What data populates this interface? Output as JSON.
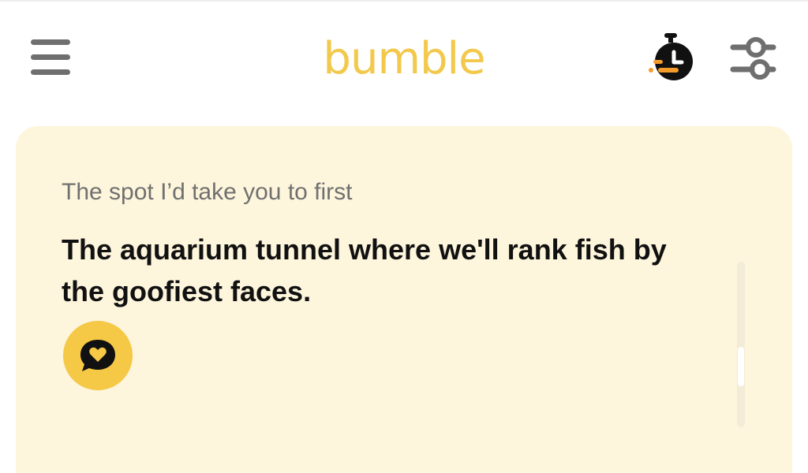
{
  "header": {
    "logo_text": "bumble",
    "menu_icon": "hamburger-menu-icon",
    "timer_icon": "stopwatch-icon",
    "filter_icon": "filter-sliders-icon"
  },
  "profile_card": {
    "prompt_label": "The spot I’d take you to first",
    "answer_text": "The aquarium tunnel where we'll rank fish by the goofiest faces.",
    "comment_icon": "heart-chat-bubble-icon"
  },
  "colors": {
    "brand_yellow": "#f2c94c",
    "card_background": "#fdf5dc",
    "accent_orange": "#f59b2b",
    "icon_gray": "#6f6f6f"
  }
}
